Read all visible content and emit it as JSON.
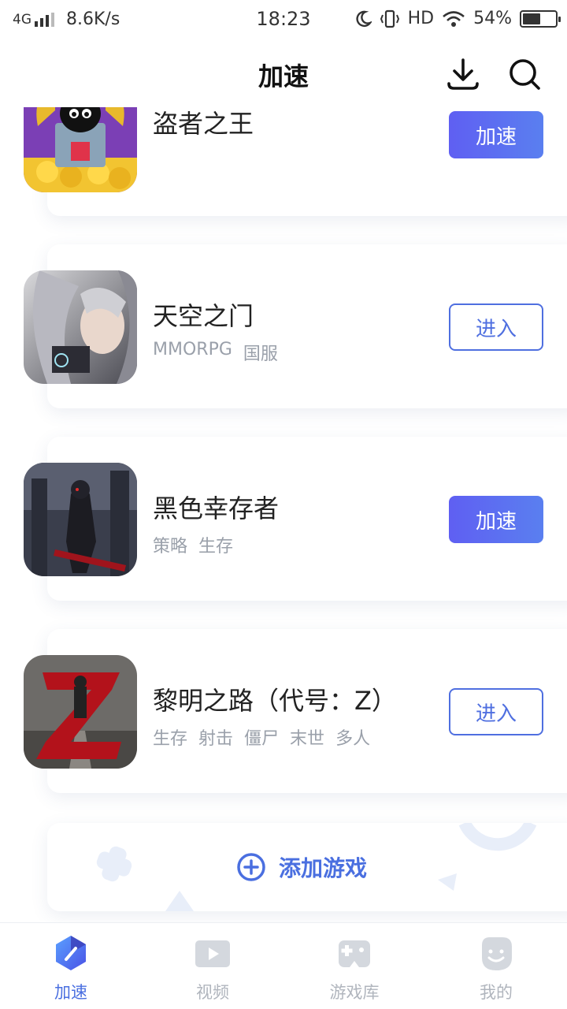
{
  "status_bar": {
    "network": "4G",
    "speed": "8.6K/s",
    "time": "18:23",
    "hd": "HD",
    "battery": "54%"
  },
  "header": {
    "title": "加速",
    "icons": [
      "download-icon",
      "search-icon"
    ]
  },
  "games": [
    {
      "name": "盗者之王",
      "tags": [],
      "action": "加速",
      "action_type": "accelerate"
    },
    {
      "name": "天空之门",
      "tags": [
        "MMORPG",
        "国服"
      ],
      "action": "进入",
      "action_type": "enter"
    },
    {
      "name": "黑色幸存者",
      "tags": [
        "策略",
        "生存"
      ],
      "action": "加速",
      "action_type": "accelerate"
    },
    {
      "name": "黎明之路（代号：Z）",
      "tags": [
        "生存",
        "射击",
        "僵尸",
        "末世",
        "多人"
      ],
      "action": "进入",
      "action_type": "enter"
    }
  ],
  "add_game": {
    "label": "添加游戏"
  },
  "bottom_nav": [
    {
      "label": "加速",
      "icon": "accelerate-icon",
      "active": true
    },
    {
      "label": "视频",
      "icon": "video-icon",
      "active": false
    },
    {
      "label": "游戏库",
      "icon": "gamepad-icon",
      "active": false
    },
    {
      "label": "我的",
      "icon": "profile-icon",
      "active": false
    }
  ],
  "colors": {
    "accent": "#4a6fe0",
    "accelerate_button": "#5f5ff2",
    "tag_text": "#9aa0aa",
    "nav_inactive": "#b0b5bd"
  }
}
